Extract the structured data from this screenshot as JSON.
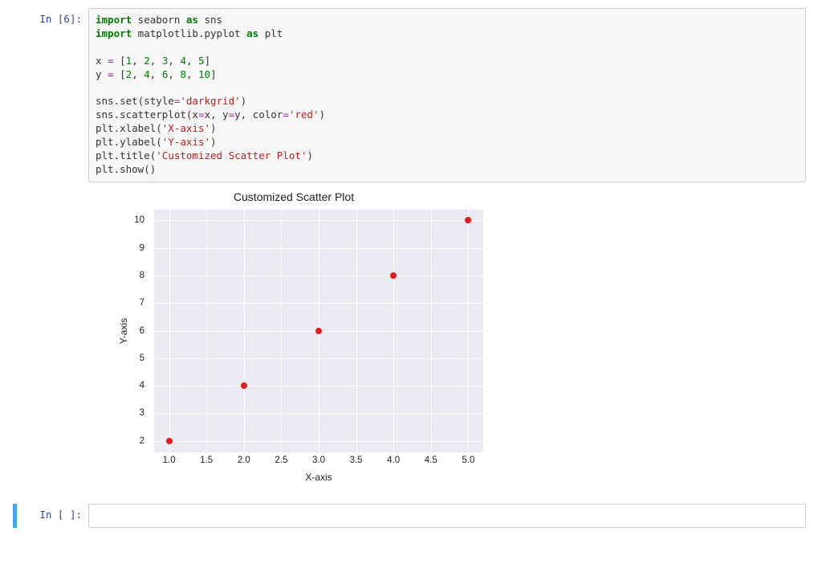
{
  "cells": {
    "executed": {
      "prompt": "In [6]:",
      "code_lines": [
        {
          "segments": [
            {
              "t": "import",
              "c": "kw"
            },
            {
              "t": " seaborn ",
              "c": "nm"
            },
            {
              "t": "as",
              "c": "kw"
            },
            {
              "t": " sns",
              "c": "nm"
            }
          ]
        },
        {
          "segments": [
            {
              "t": "import",
              "c": "kw"
            },
            {
              "t": " matplotlib.pyplot ",
              "c": "nm"
            },
            {
              "t": "as",
              "c": "kw"
            },
            {
              "t": " plt",
              "c": "nm"
            }
          ]
        },
        {
          "segments": [
            {
              "t": "",
              "c": "nm"
            }
          ]
        },
        {
          "segments": [
            {
              "t": "x ",
              "c": "nm"
            },
            {
              "t": "=",
              "c": "op"
            },
            {
              "t": " [",
              "c": "nm"
            },
            {
              "t": "1",
              "c": "num"
            },
            {
              "t": ", ",
              "c": "nm"
            },
            {
              "t": "2",
              "c": "num"
            },
            {
              "t": ", ",
              "c": "nm"
            },
            {
              "t": "3",
              "c": "num"
            },
            {
              "t": ", ",
              "c": "nm"
            },
            {
              "t": "4",
              "c": "num"
            },
            {
              "t": ", ",
              "c": "nm"
            },
            {
              "t": "5",
              "c": "num"
            },
            {
              "t": "]",
              "c": "nm"
            }
          ]
        },
        {
          "segments": [
            {
              "t": "y ",
              "c": "nm"
            },
            {
              "t": "=",
              "c": "op"
            },
            {
              "t": " [",
              "c": "nm"
            },
            {
              "t": "2",
              "c": "num"
            },
            {
              "t": ", ",
              "c": "nm"
            },
            {
              "t": "4",
              "c": "num"
            },
            {
              "t": ", ",
              "c": "nm"
            },
            {
              "t": "6",
              "c": "num"
            },
            {
              "t": ", ",
              "c": "nm"
            },
            {
              "t": "8",
              "c": "num"
            },
            {
              "t": ", ",
              "c": "nm"
            },
            {
              "t": "10",
              "c": "num"
            },
            {
              "t": "]",
              "c": "nm"
            }
          ]
        },
        {
          "segments": [
            {
              "t": "",
              "c": "nm"
            }
          ]
        },
        {
          "segments": [
            {
              "t": "sns.set(style",
              "c": "nm"
            },
            {
              "t": "=",
              "c": "op"
            },
            {
              "t": "'darkgrid'",
              "c": "str"
            },
            {
              "t": ")",
              "c": "nm"
            }
          ]
        },
        {
          "segments": [
            {
              "t": "sns.scatterplot(x",
              "c": "nm"
            },
            {
              "t": "=",
              "c": "op"
            },
            {
              "t": "x, y",
              "c": "nm"
            },
            {
              "t": "=",
              "c": "op"
            },
            {
              "t": "y, color",
              "c": "nm"
            },
            {
              "t": "=",
              "c": "op"
            },
            {
              "t": "'red'",
              "c": "str"
            },
            {
              "t": ")",
              "c": "nm"
            }
          ]
        },
        {
          "segments": [
            {
              "t": "plt.xlabel(",
              "c": "nm"
            },
            {
              "t": "'X-axis'",
              "c": "str"
            },
            {
              "t": ")",
              "c": "nm"
            }
          ]
        },
        {
          "segments": [
            {
              "t": "plt.ylabel(",
              "c": "nm"
            },
            {
              "t": "'Y-axis'",
              "c": "str"
            },
            {
              "t": ")",
              "c": "nm"
            }
          ]
        },
        {
          "segments": [
            {
              "t": "plt.title(",
              "c": "nm"
            },
            {
              "t": "'Customized Scatter Plot'",
              "c": "str"
            },
            {
              "t": ")",
              "c": "nm"
            }
          ]
        },
        {
          "segments": [
            {
              "t": "plt.show()",
              "c": "nm"
            }
          ]
        }
      ]
    },
    "empty": {
      "prompt": "In [ ]:"
    }
  },
  "chart_data": {
    "type": "scatter",
    "title": "Customized Scatter Plot",
    "xlabel": "X-axis",
    "ylabel": "Y-axis",
    "x": [
      1,
      2,
      3,
      4,
      5
    ],
    "y": [
      2,
      4,
      6,
      8,
      10
    ],
    "color": "#e41a1c",
    "xlim": [
      0.8,
      5.2
    ],
    "ylim": [
      1.6,
      10.4
    ],
    "x_ticks": [
      "1.0",
      "1.5",
      "2.0",
      "2.5",
      "3.0",
      "3.5",
      "4.0",
      "4.5",
      "5.0"
    ],
    "y_ticks": [
      "2",
      "3",
      "4",
      "5",
      "6",
      "7",
      "8",
      "9",
      "10"
    ],
    "grid": true,
    "bg": "#eaeaf2"
  }
}
